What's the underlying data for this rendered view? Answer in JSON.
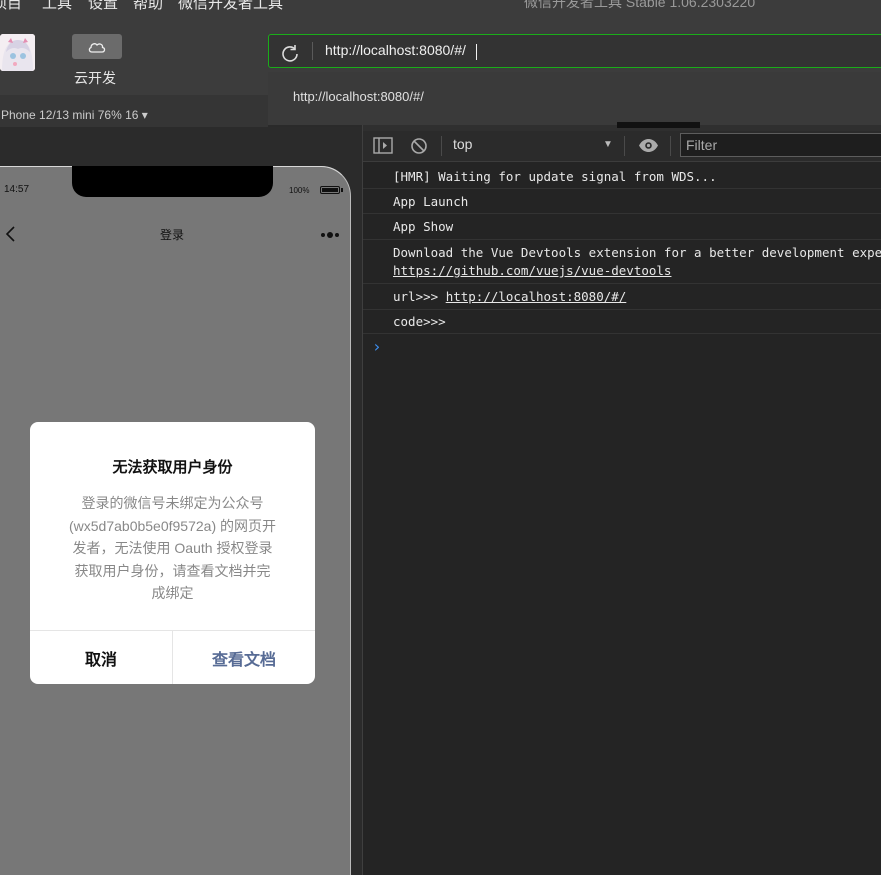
{
  "menu": {
    "items": [
      "项目",
      "工具",
      "设置",
      "帮助",
      "微信开发者工具"
    ],
    "window_title": "微信开发者工具 Stable 1.06.2303220"
  },
  "toolbar": {
    "cloud_label": "云开发"
  },
  "address_bar": {
    "url": "http://localhost:8080/#/",
    "suggestion": "http://localhost:8080/#/"
  },
  "device": {
    "label": "Phone 12/13 mini 76% 16 ▾"
  },
  "phone": {
    "time": "14:57",
    "battery": "100%",
    "nav_title": "登录"
  },
  "modal": {
    "title": "无法获取用户身份",
    "body_lines": [
      "登录的微信号未绑定为公众号",
      "(wx5d7ab0b5e0f9572a) 的网页开",
      "发者，无法使用 Oauth 授权登录",
      "获取用户身份，请查看文档并完",
      "成绑定"
    ],
    "cancel": "取消",
    "confirm": "查看文档"
  },
  "console": {
    "context": "top",
    "filter_placeholder": "Filter",
    "logs": [
      {
        "text": "[HMR] Waiting for update signal from WDS..."
      },
      {
        "text": "App Launch"
      },
      {
        "text": "App Show"
      },
      {
        "text": "Download the Vue Devtools extension for a better development experience:",
        "link": "https://github.com/vuejs/vue-devtools"
      },
      {
        "text": "url>>> ",
        "link": "http://localhost:8080/#/"
      },
      {
        "text": "code>>>"
      }
    ]
  },
  "colors": {
    "accent_green": "#1aad19",
    "link_blue": "#576b95",
    "prompt_blue": "#3d8ff0"
  }
}
